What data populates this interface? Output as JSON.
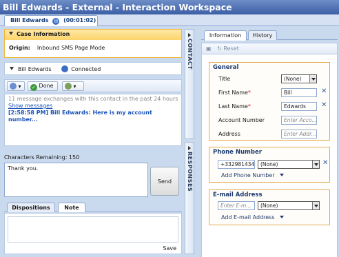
{
  "window": {
    "title": "Bill Edwards - External - Interaction Workspace"
  },
  "interaction_tab": {
    "name": "Bill Edwards",
    "timer": "(00:01:02)"
  },
  "case_info": {
    "header": "Case Information",
    "origin_label": "Origin:",
    "origin_value": "Inbound SMS Page Mode"
  },
  "party": {
    "name": "Bill Edwards",
    "status": "Connected"
  },
  "toolbar": {
    "done_label": "Done"
  },
  "transcript": {
    "summary": "11 message exchanges with this contact in the past 24 hours",
    "show_messages": "Show messages",
    "last_message": "[2:58:58 PM] Bill Edwards: Here is my account number..."
  },
  "compose": {
    "chars_remaining": "Characters Remaining: 150",
    "text": "Thank you.",
    "send_label": "Send"
  },
  "bottom_tabs": [
    {
      "label": "Dispositions"
    },
    {
      "label": "Note"
    }
  ],
  "note": {
    "save_label": "Save"
  },
  "side_panels": {
    "contact": "CONTACT",
    "responses": "RESPONSES"
  },
  "contact_tabs": [
    {
      "label": "Information"
    },
    {
      "label": "History"
    }
  ],
  "contact_toolbar": {
    "reset_label": "Reset"
  },
  "general": {
    "header": "General",
    "title_label": "Title",
    "title_value": "(None)",
    "first_name_label": "First Name",
    "first_name_value": "Bill",
    "last_name_label": "Last Name",
    "last_name_value": "Edwards",
    "account_label": "Account Number",
    "account_placeholder": "Enter Acco...",
    "address_label": "Address",
    "address_placeholder": "Enter Addr..."
  },
  "phone": {
    "header": "Phone Number",
    "number_value": "+332981434",
    "type_value": "(None)",
    "add_label": "Add Phone Number"
  },
  "email": {
    "header": "E-mail Address",
    "placeholder": "Enter E-m...",
    "type_value": "(None)",
    "add_label": "Add E-mail Address"
  },
  "colors": {
    "title_bar": "#3c5fa6",
    "case_border": "#f0b73a",
    "group_border": "#e3a94a",
    "link_blue": "#1a52b8"
  },
  "icons": [
    "interaction-status-icon",
    "collapse-triangle-icon",
    "party-status-icon",
    "party-action-icon",
    "done-check-icon",
    "consult-icon",
    "save-icon",
    "reset-icon",
    "remove-x-icon",
    "dropdown-arrow-icon"
  ]
}
